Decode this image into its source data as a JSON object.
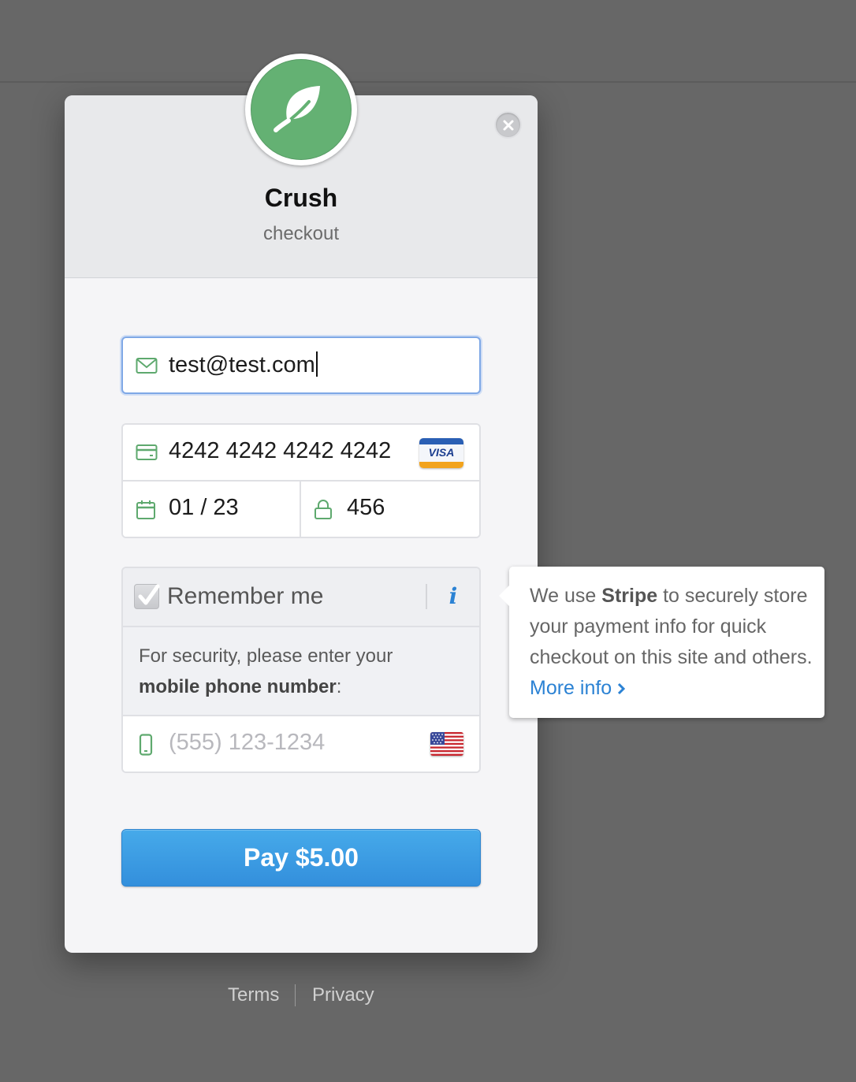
{
  "merchant": {
    "name": "Crush",
    "subtitle": "checkout",
    "logo_icon": "leaf-icon",
    "logo_color": "#64b173"
  },
  "form": {
    "email": {
      "value": "test@test.com",
      "icon": "envelope-icon"
    },
    "card_number": {
      "value": "4242 4242 4242 4242",
      "icon": "credit-card-icon",
      "brand": "VISA"
    },
    "expiry": {
      "value": "01 / 23",
      "icon": "calendar-icon"
    },
    "cvc": {
      "value": "456",
      "icon": "lock-icon"
    },
    "remember": {
      "label": "Remember me",
      "checked": true,
      "info_icon": "i",
      "security_text_prefix": "For security, please enter your",
      "security_text_bold": "mobile phone number",
      "security_text_suffix": ":"
    },
    "phone": {
      "placeholder": "(555) 123-1234",
      "icon": "mobile-phone-icon",
      "flag": "us-flag-icon"
    }
  },
  "pay_button": {
    "label": "Pay $5.00",
    "color": "#3b9ae2"
  },
  "tooltip": {
    "text_prefix": "We use",
    "text_bold": "Stripe",
    "text_suffix": "to securely store your payment info for quick checkout on this site and others.",
    "link": "More info"
  },
  "footer": {
    "terms": "Terms",
    "privacy": "Privacy"
  }
}
